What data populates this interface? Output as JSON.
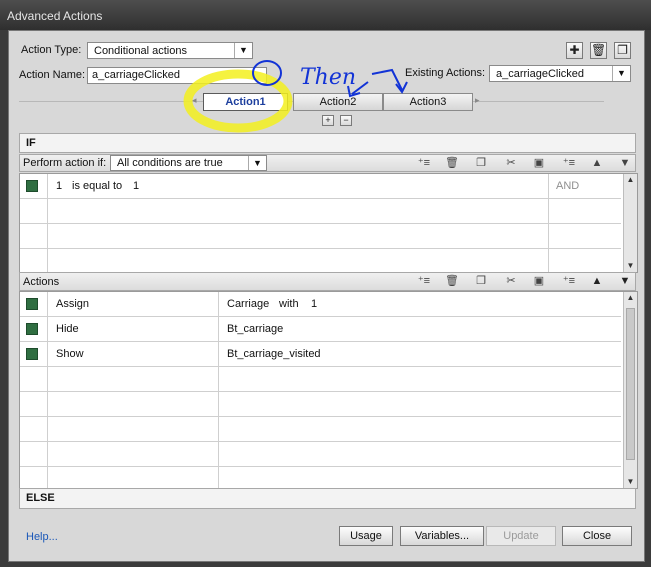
{
  "window": {
    "title": "Advanced Actions"
  },
  "header": {
    "action_type_label": "Action Type:",
    "action_type_value": "Conditional actions",
    "action_name_label": "Action Name:",
    "action_name_value": "a_carriageClicked",
    "existing_actions_label": "Existing Actions:",
    "existing_actions_value": "a_carriageClicked"
  },
  "tabs": [
    {
      "label": "Action1",
      "active": true
    },
    {
      "label": "Action2",
      "active": false
    },
    {
      "label": "Action3",
      "active": false
    }
  ],
  "if_section": {
    "header": "IF",
    "perform_label": "Perform action if:",
    "perform_value": "All conditions are true",
    "conditions": [
      {
        "left": "1",
        "operator": "is equal to",
        "right": "1",
        "logic": "AND"
      }
    ]
  },
  "actions_section": {
    "header": "Actions",
    "rows": [
      {
        "action": "Assign",
        "target": "Carriage",
        "keyword": "with",
        "value": "1"
      },
      {
        "action": "Hide",
        "target": "Bt_carriage",
        "keyword": "",
        "value": ""
      },
      {
        "action": "Show",
        "target": "Bt_carriage_visited",
        "keyword": "",
        "value": ""
      }
    ]
  },
  "else_section": {
    "header": "ELSE"
  },
  "footer": {
    "help": "Help...",
    "usage": "Usage",
    "variables": "Variables...",
    "update": "Update",
    "close": "Close"
  },
  "annotation": {
    "text": "Then",
    "highlight_color": "#f3f01e",
    "ink_color": "#1233d6"
  },
  "colors": {
    "tab_active_text": "#1d3f9e",
    "checkbox_green": "#2f6e41",
    "help_link": "#1a57b8"
  }
}
